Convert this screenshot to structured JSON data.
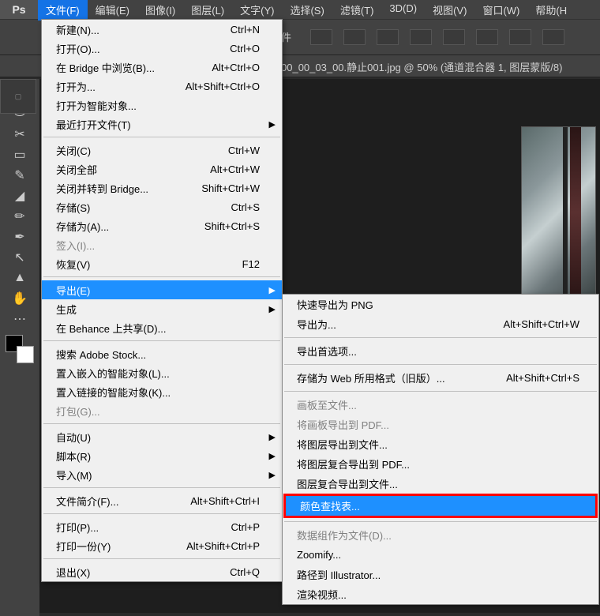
{
  "menubar": {
    "items": [
      "文件(F)",
      "编辑(E)",
      "图像(I)",
      "图层(L)",
      "文字(Y)",
      "选择(S)",
      "滤镜(T)",
      "3D(D)",
      "视图(V)",
      "窗口(W)",
      "帮助(H"
    ]
  },
  "doc_tab": "00_00_03_00.静止001.jpg @ 50% (通道混合器 1, 图层蒙版/8)",
  "option_bar_trailing": "件",
  "file_menu": [
    {
      "label": "新建(N)...",
      "accel": "Ctrl+N"
    },
    {
      "label": "打开(O)...",
      "accel": "Ctrl+O"
    },
    {
      "label": "在 Bridge 中浏览(B)...",
      "accel": "Alt+Ctrl+O"
    },
    {
      "label": "打开为...",
      "accel": "Alt+Shift+Ctrl+O"
    },
    {
      "label": "打开为智能对象..."
    },
    {
      "label": "最近打开文件(T)",
      "arrow": true
    },
    {
      "sep": true
    },
    {
      "label": "关闭(C)",
      "accel": "Ctrl+W"
    },
    {
      "label": "关闭全部",
      "accel": "Alt+Ctrl+W"
    },
    {
      "label": "关闭并转到 Bridge...",
      "accel": "Shift+Ctrl+W"
    },
    {
      "label": "存储(S)",
      "accel": "Ctrl+S"
    },
    {
      "label": "存储为(A)...",
      "accel": "Shift+Ctrl+S"
    },
    {
      "label": "签入(I)...",
      "disabled": true
    },
    {
      "label": "恢复(V)",
      "accel": "F12"
    },
    {
      "sep": true
    },
    {
      "label": "导出(E)",
      "arrow": true,
      "highlight": true
    },
    {
      "label": "生成",
      "arrow": true
    },
    {
      "label": "在 Behance 上共享(D)..."
    },
    {
      "sep": true
    },
    {
      "label": "搜索 Adobe Stock..."
    },
    {
      "label": "置入嵌入的智能对象(L)..."
    },
    {
      "label": "置入链接的智能对象(K)..."
    },
    {
      "label": "打包(G)...",
      "disabled": true
    },
    {
      "sep": true
    },
    {
      "label": "自动(U)",
      "arrow": true
    },
    {
      "label": "脚本(R)",
      "arrow": true
    },
    {
      "label": "导入(M)",
      "arrow": true
    },
    {
      "sep": true
    },
    {
      "label": "文件简介(F)...",
      "accel": "Alt+Shift+Ctrl+I"
    },
    {
      "sep": true
    },
    {
      "label": "打印(P)...",
      "accel": "Ctrl+P"
    },
    {
      "label": "打印一份(Y)",
      "accel": "Alt+Shift+Ctrl+P"
    },
    {
      "sep": true
    },
    {
      "label": "退出(X)",
      "accel": "Ctrl+Q"
    }
  ],
  "export_menu": [
    {
      "label": "快速导出为 PNG"
    },
    {
      "label": "导出为...",
      "accel": "Alt+Shift+Ctrl+W"
    },
    {
      "sep": true
    },
    {
      "label": "导出首选项..."
    },
    {
      "sep": true
    },
    {
      "label": "存储为 Web 所用格式（旧版）...",
      "accel": "Alt+Shift+Ctrl+S"
    },
    {
      "sep": true
    },
    {
      "label": "画板至文件...",
      "disabled": true
    },
    {
      "label": "将画板导出到 PDF...",
      "disabled": true
    },
    {
      "label": "将图层导出到文件..."
    },
    {
      "label": "将图层复合导出到 PDF..."
    },
    {
      "label": "图层复合导出到文件..."
    },
    {
      "label": "颜色查找表...",
      "highlight": true,
      "redbox": true
    },
    {
      "sep": true
    },
    {
      "label": "数据组作为文件(D)...",
      "disabled": true
    },
    {
      "label": "Zoomify..."
    },
    {
      "label": "路径到 Illustrator..."
    },
    {
      "label": "渲染视频..."
    }
  ]
}
